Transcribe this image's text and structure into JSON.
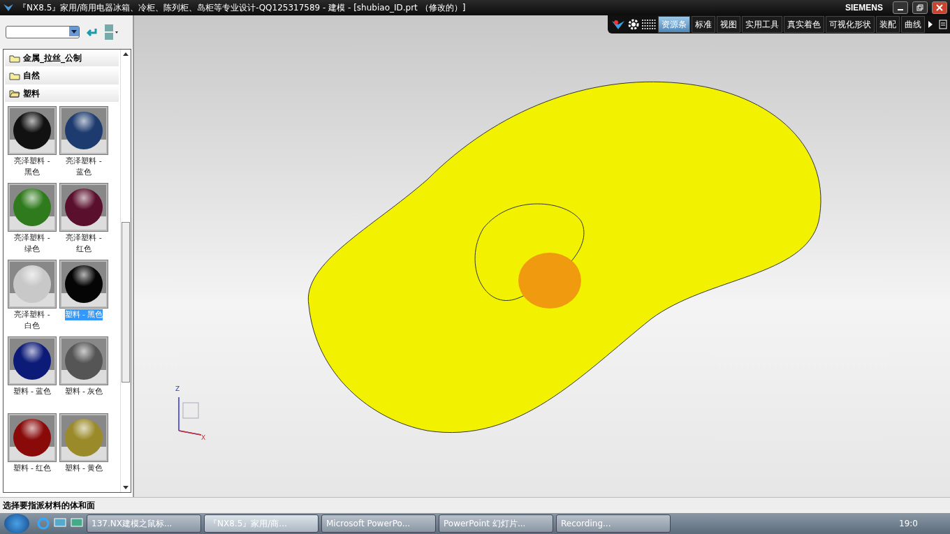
{
  "window": {
    "title": "『NX8.5』家用/商用电器冰箱、冷柜、陈列柜、岛柜等专业设计-QQ125317589 - 建模 - [shubiao_ID.prt （修改的）]",
    "brand": "SIEMENS"
  },
  "toolbar": {
    "tabs": [
      {
        "label": "资源条",
        "selected": true
      },
      {
        "label": "标准",
        "selected": false
      },
      {
        "label": "视图",
        "selected": false
      },
      {
        "label": "实用工具",
        "selected": false
      },
      {
        "label": "真实着色",
        "selected": false
      },
      {
        "label": "可视化形状",
        "selected": false
      },
      {
        "label": "装配",
        "selected": false
      },
      {
        "label": "曲线",
        "selected": false
      }
    ]
  },
  "sidebar": {
    "folders": [
      {
        "label": "金属_拉丝_公制",
        "expanded": false
      },
      {
        "label": "自然",
        "expanded": false
      },
      {
        "label": "塑料",
        "expanded": true
      }
    ],
    "materials": [
      {
        "label": "亮泽塑料 - 黑色",
        "color": "#111111",
        "selected": false
      },
      {
        "label": "亮泽塑料 - 蓝色",
        "color": "#1d3b6e",
        "selected": false
      },
      {
        "label": "亮泽塑料 - 绿色",
        "color": "#2e7a1c",
        "selected": false
      },
      {
        "label": "亮泽塑料 - 红色",
        "color": "#5a0f2c",
        "selected": false
      },
      {
        "label": "亮泽塑料 - 白色",
        "color": "#c8c8c8",
        "selected": false
      },
      {
        "label": "塑料 - 黑色",
        "color": "#050505",
        "selected": true
      },
      {
        "label": "塑料 - 蓝色",
        "color": "#0c1a78",
        "selected": false
      },
      {
        "label": "塑料 - 灰色",
        "color": "#555555",
        "selected": false
      },
      {
        "label": "塑料 - 红色",
        "color": "#8a0a0a",
        "selected": false
      },
      {
        "label": "塑料 - 黄色",
        "color": "#9a8a2a",
        "selected": false
      }
    ]
  },
  "triad": {
    "z_label": "Z",
    "x_label": "X"
  },
  "status_bar": {
    "text": "选择要指派材料的体和面"
  },
  "taskbar": {
    "items": [
      {
        "label": "137.NX建模之鼠标...",
        "selected": false
      },
      {
        "label": "『NX8.5』家用/商...",
        "selected": true
      },
      {
        "label": "Microsoft PowerPo...",
        "selected": false
      },
      {
        "label": "PowerPoint 幻灯片...",
        "selected": false
      },
      {
        "label": "Recording...",
        "selected": false
      }
    ],
    "clock": "19:0"
  }
}
